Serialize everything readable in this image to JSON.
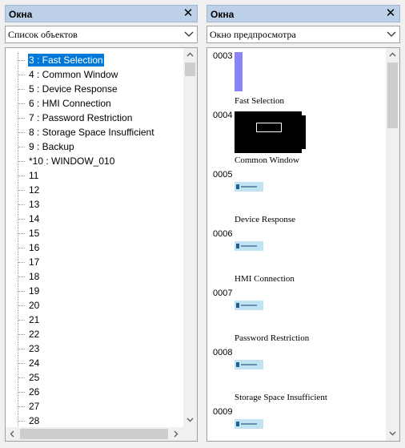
{
  "objects_panel": {
    "title": "Окна",
    "close_glyph": "✕",
    "combo_value": "Список объектов",
    "items": [
      {
        "label": "3 : Fast Selection",
        "selected": true
      },
      {
        "label": "4 : Common Window"
      },
      {
        "label": "5 : Device Response"
      },
      {
        "label": "6 : HMI Connection"
      },
      {
        "label": "7 : Password Restriction"
      },
      {
        "label": "8 : Storage Space Insufficient"
      },
      {
        "label": "9 : Backup"
      },
      {
        "label": "*10 : WINDOW_010"
      },
      {
        "label": "11"
      },
      {
        "label": "12"
      },
      {
        "label": "13"
      },
      {
        "label": "14"
      },
      {
        "label": "15"
      },
      {
        "label": "16"
      },
      {
        "label": "17"
      },
      {
        "label": "18"
      },
      {
        "label": "19"
      },
      {
        "label": "20"
      },
      {
        "label": "21"
      },
      {
        "label": "22"
      },
      {
        "label": "23"
      },
      {
        "label": "24"
      },
      {
        "label": "25"
      },
      {
        "label": "26"
      },
      {
        "label": "27"
      },
      {
        "label": "28"
      }
    ]
  },
  "preview_panel": {
    "title": "Окна",
    "close_glyph": "✕",
    "combo_value": "Окно предпросмотра",
    "items": [
      {
        "number": "0003",
        "name": "Fast Selection",
        "thumb": "fast-selection"
      },
      {
        "number": "0004",
        "name": "Common Window",
        "thumb": "common-window"
      },
      {
        "number": "0005",
        "name": "Device Response",
        "thumb": "mini"
      },
      {
        "number": "0006",
        "name": "HMI Connection",
        "thumb": "mini"
      },
      {
        "number": "0007",
        "name": "Password Restriction",
        "thumb": "mini"
      },
      {
        "number": "0008",
        "name": "Storage Space Insufficient",
        "thumb": "mini"
      },
      {
        "number": "0009",
        "name": "",
        "thumb": "mini"
      }
    ]
  },
  "colors": {
    "titlebar": "#bcd1e8",
    "selection": "#0078d7",
    "fast_selection_thumb": "#8b84f8",
    "mini_thumb": "#bfe3f3"
  }
}
